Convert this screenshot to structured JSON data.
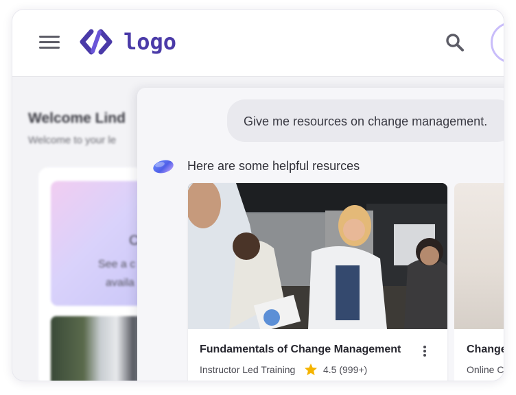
{
  "header": {
    "logo_text": "logo",
    "icons": [
      "menu-icon",
      "logo-mark-icon",
      "search-icon",
      "avatar"
    ]
  },
  "background": {
    "welcome_title": "Welcome Lind",
    "welcome_sub": "Welcome to your le",
    "card_line1": "C",
    "card_line2": "See a c",
    "card_line3": "availa"
  },
  "chat": {
    "user_message": "Give me resources on change management.",
    "bot_message": "Here are some helpful resurces",
    "cards": [
      {
        "title": "Fundamentals of Change Management",
        "type": "Instructor Led Training",
        "rating": "4.5 (999+)"
      },
      {
        "title": "Change",
        "type": "Online C"
      }
    ]
  },
  "colors": {
    "brand": "#4a3aa8",
    "star": "#f5b400",
    "avatar_ring": "#c9bdfa",
    "bubble": "#e9e9ee"
  }
}
